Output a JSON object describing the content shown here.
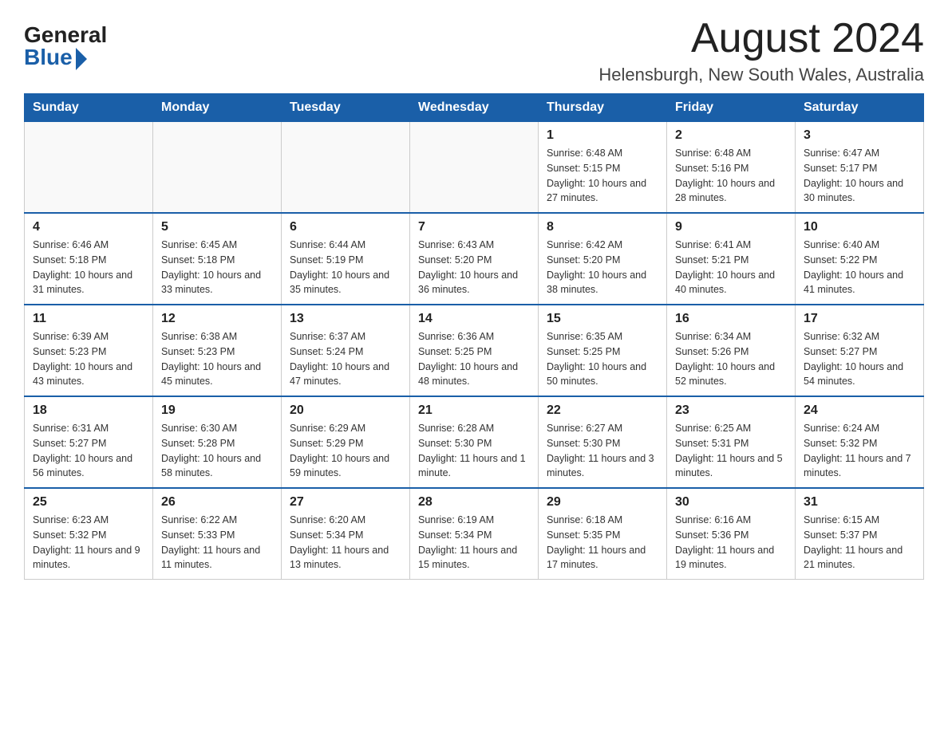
{
  "logo": {
    "general": "General",
    "blue": "Blue"
  },
  "title": "August 2024",
  "location": "Helensburgh, New South Wales, Australia",
  "days_of_week": [
    "Sunday",
    "Monday",
    "Tuesday",
    "Wednesday",
    "Thursday",
    "Friday",
    "Saturday"
  ],
  "weeks": [
    [
      {
        "day": "",
        "info": ""
      },
      {
        "day": "",
        "info": ""
      },
      {
        "day": "",
        "info": ""
      },
      {
        "day": "",
        "info": ""
      },
      {
        "day": "1",
        "info": "Sunrise: 6:48 AM\nSunset: 5:15 PM\nDaylight: 10 hours and 27 minutes."
      },
      {
        "day": "2",
        "info": "Sunrise: 6:48 AM\nSunset: 5:16 PM\nDaylight: 10 hours and 28 minutes."
      },
      {
        "day": "3",
        "info": "Sunrise: 6:47 AM\nSunset: 5:17 PM\nDaylight: 10 hours and 30 minutes."
      }
    ],
    [
      {
        "day": "4",
        "info": "Sunrise: 6:46 AM\nSunset: 5:18 PM\nDaylight: 10 hours and 31 minutes."
      },
      {
        "day": "5",
        "info": "Sunrise: 6:45 AM\nSunset: 5:18 PM\nDaylight: 10 hours and 33 minutes."
      },
      {
        "day": "6",
        "info": "Sunrise: 6:44 AM\nSunset: 5:19 PM\nDaylight: 10 hours and 35 minutes."
      },
      {
        "day": "7",
        "info": "Sunrise: 6:43 AM\nSunset: 5:20 PM\nDaylight: 10 hours and 36 minutes."
      },
      {
        "day": "8",
        "info": "Sunrise: 6:42 AM\nSunset: 5:20 PM\nDaylight: 10 hours and 38 minutes."
      },
      {
        "day": "9",
        "info": "Sunrise: 6:41 AM\nSunset: 5:21 PM\nDaylight: 10 hours and 40 minutes."
      },
      {
        "day": "10",
        "info": "Sunrise: 6:40 AM\nSunset: 5:22 PM\nDaylight: 10 hours and 41 minutes."
      }
    ],
    [
      {
        "day": "11",
        "info": "Sunrise: 6:39 AM\nSunset: 5:23 PM\nDaylight: 10 hours and 43 minutes."
      },
      {
        "day": "12",
        "info": "Sunrise: 6:38 AM\nSunset: 5:23 PM\nDaylight: 10 hours and 45 minutes."
      },
      {
        "day": "13",
        "info": "Sunrise: 6:37 AM\nSunset: 5:24 PM\nDaylight: 10 hours and 47 minutes."
      },
      {
        "day": "14",
        "info": "Sunrise: 6:36 AM\nSunset: 5:25 PM\nDaylight: 10 hours and 48 minutes."
      },
      {
        "day": "15",
        "info": "Sunrise: 6:35 AM\nSunset: 5:25 PM\nDaylight: 10 hours and 50 minutes."
      },
      {
        "day": "16",
        "info": "Sunrise: 6:34 AM\nSunset: 5:26 PM\nDaylight: 10 hours and 52 minutes."
      },
      {
        "day": "17",
        "info": "Sunrise: 6:32 AM\nSunset: 5:27 PM\nDaylight: 10 hours and 54 minutes."
      }
    ],
    [
      {
        "day": "18",
        "info": "Sunrise: 6:31 AM\nSunset: 5:27 PM\nDaylight: 10 hours and 56 minutes."
      },
      {
        "day": "19",
        "info": "Sunrise: 6:30 AM\nSunset: 5:28 PM\nDaylight: 10 hours and 58 minutes."
      },
      {
        "day": "20",
        "info": "Sunrise: 6:29 AM\nSunset: 5:29 PM\nDaylight: 10 hours and 59 minutes."
      },
      {
        "day": "21",
        "info": "Sunrise: 6:28 AM\nSunset: 5:30 PM\nDaylight: 11 hours and 1 minute."
      },
      {
        "day": "22",
        "info": "Sunrise: 6:27 AM\nSunset: 5:30 PM\nDaylight: 11 hours and 3 minutes."
      },
      {
        "day": "23",
        "info": "Sunrise: 6:25 AM\nSunset: 5:31 PM\nDaylight: 11 hours and 5 minutes."
      },
      {
        "day": "24",
        "info": "Sunrise: 6:24 AM\nSunset: 5:32 PM\nDaylight: 11 hours and 7 minutes."
      }
    ],
    [
      {
        "day": "25",
        "info": "Sunrise: 6:23 AM\nSunset: 5:32 PM\nDaylight: 11 hours and 9 minutes."
      },
      {
        "day": "26",
        "info": "Sunrise: 6:22 AM\nSunset: 5:33 PM\nDaylight: 11 hours and 11 minutes."
      },
      {
        "day": "27",
        "info": "Sunrise: 6:20 AM\nSunset: 5:34 PM\nDaylight: 11 hours and 13 minutes."
      },
      {
        "day": "28",
        "info": "Sunrise: 6:19 AM\nSunset: 5:34 PM\nDaylight: 11 hours and 15 minutes."
      },
      {
        "day": "29",
        "info": "Sunrise: 6:18 AM\nSunset: 5:35 PM\nDaylight: 11 hours and 17 minutes."
      },
      {
        "day": "30",
        "info": "Sunrise: 6:16 AM\nSunset: 5:36 PM\nDaylight: 11 hours and 19 minutes."
      },
      {
        "day": "31",
        "info": "Sunrise: 6:15 AM\nSunset: 5:37 PM\nDaylight: 11 hours and 21 minutes."
      }
    ]
  ]
}
